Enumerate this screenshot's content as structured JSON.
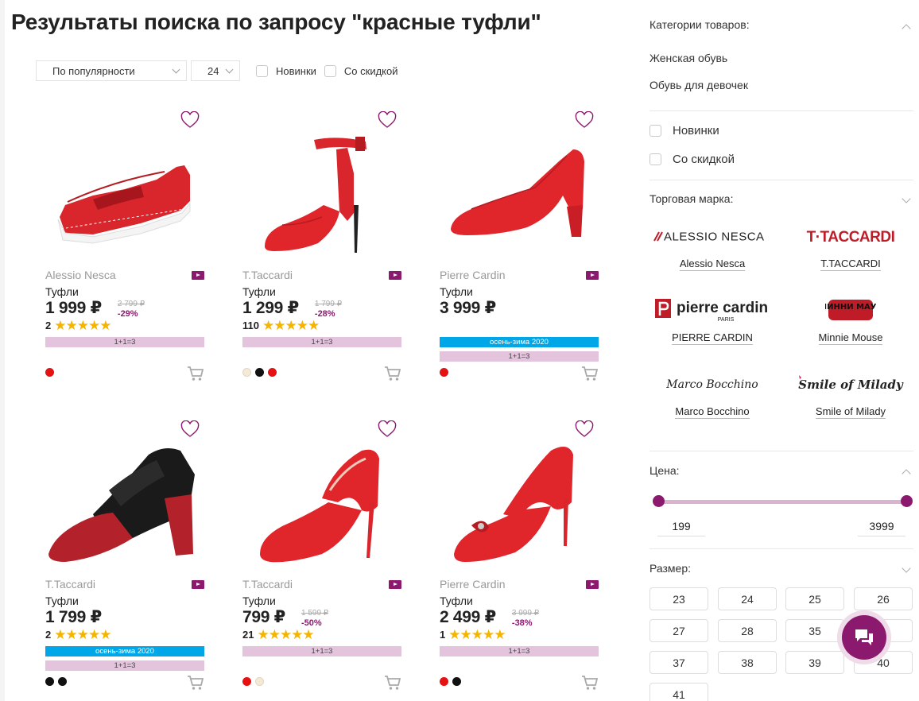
{
  "page": {
    "title": "Результаты поиска по запросу \"красные туфли\""
  },
  "toolbar": {
    "sort_value": "По популярности",
    "per_page_value": "24",
    "filter_new_label": "Новинки",
    "filter_sale_label": "Со скидкой"
  },
  "products": [
    {
      "brand": "Alessio Nesca",
      "type": "Туфли",
      "price": "1 999 ₽",
      "old_price": "2 799 ₽",
      "discount": "-29%",
      "reviews": "2",
      "rating": 5,
      "season_tag": "",
      "promo_tag": "1+1=3",
      "colors": [
        "#e41212"
      ]
    },
    {
      "brand": "T.Taccardi",
      "type": "Туфли",
      "price": "1 299 ₽",
      "old_price": "1 799 ₽",
      "discount": "-28%",
      "reviews": "110",
      "rating": 5,
      "season_tag": "",
      "promo_tag": "1+1=3",
      "colors": [
        "#f5ead8",
        "#111111",
        "#e41212"
      ]
    },
    {
      "brand": "Pierre Cardin",
      "type": "Туфли",
      "price": "3 999 ₽",
      "old_price": "",
      "discount": "",
      "reviews": "",
      "rating": 0,
      "season_tag": "осень-зима 2020",
      "promo_tag": "1+1=3",
      "colors": [
        "#e41212"
      ]
    },
    {
      "brand": "T.Taccardi",
      "type": "Туфли",
      "price": "1 799 ₽",
      "old_price": "",
      "discount": "",
      "reviews": "2",
      "rating": 5,
      "season_tag": "осень-зима 2020",
      "promo_tag": "1+1=3",
      "colors": [
        "#111111",
        "#111111"
      ]
    },
    {
      "brand": "T.Taccardi",
      "type": "Туфли",
      "price": "799 ₽",
      "old_price": "1 599 ₽",
      "discount": "-50%",
      "reviews": "21",
      "rating": 5,
      "season_tag": "",
      "promo_tag": "1+1=3",
      "colors": [
        "#e41212",
        "#f5ead8"
      ]
    },
    {
      "brand": "Pierre Cardin",
      "type": "Туфли",
      "price": "2 499 ₽",
      "old_price": "3 999 ₽",
      "discount": "-38%",
      "reviews": "1",
      "rating": 5,
      "season_tag": "",
      "promo_tag": "1+1=3",
      "colors": [
        "#e41212",
        "#111111"
      ]
    }
  ],
  "sidebar": {
    "categories_title": "Категории товаров:",
    "categories": [
      "Женская обувь",
      "Обувь для девочек"
    ],
    "filter_new_label": "Новинки",
    "filter_sale_label": "Со скидкой",
    "brand_title": "Торговая марка:",
    "brand_logos": {
      "alessio": "ALESSIO NESCA",
      "taccardi": "T·TACCARDI",
      "pierre": "pierre cardin",
      "pierre_sub": "PARIS",
      "minnie": "МИННИ МАУС",
      "marco": "Marco Bocchino",
      "smile": "Smile of Milady"
    },
    "brands": [
      "Alessio Nesca",
      "T.TACCARDI",
      "PIERRE CARDIN",
      "Minnie Mouse",
      "Marco Bocchino",
      "Smile of Milady"
    ],
    "price_title": "Цена:",
    "price_min": "199",
    "price_max": "3999",
    "size_title": "Размер:",
    "sizes": [
      "23",
      "24",
      "25",
      "26",
      "27",
      "28",
      "35",
      "36",
      "37",
      "38",
      "39",
      "40",
      "41"
    ]
  },
  "colors": {
    "accent": "#8b1a6e",
    "promo_bg": "#e4c4dc",
    "season_bg": "#00a7e8",
    "star": "#f5b400"
  }
}
